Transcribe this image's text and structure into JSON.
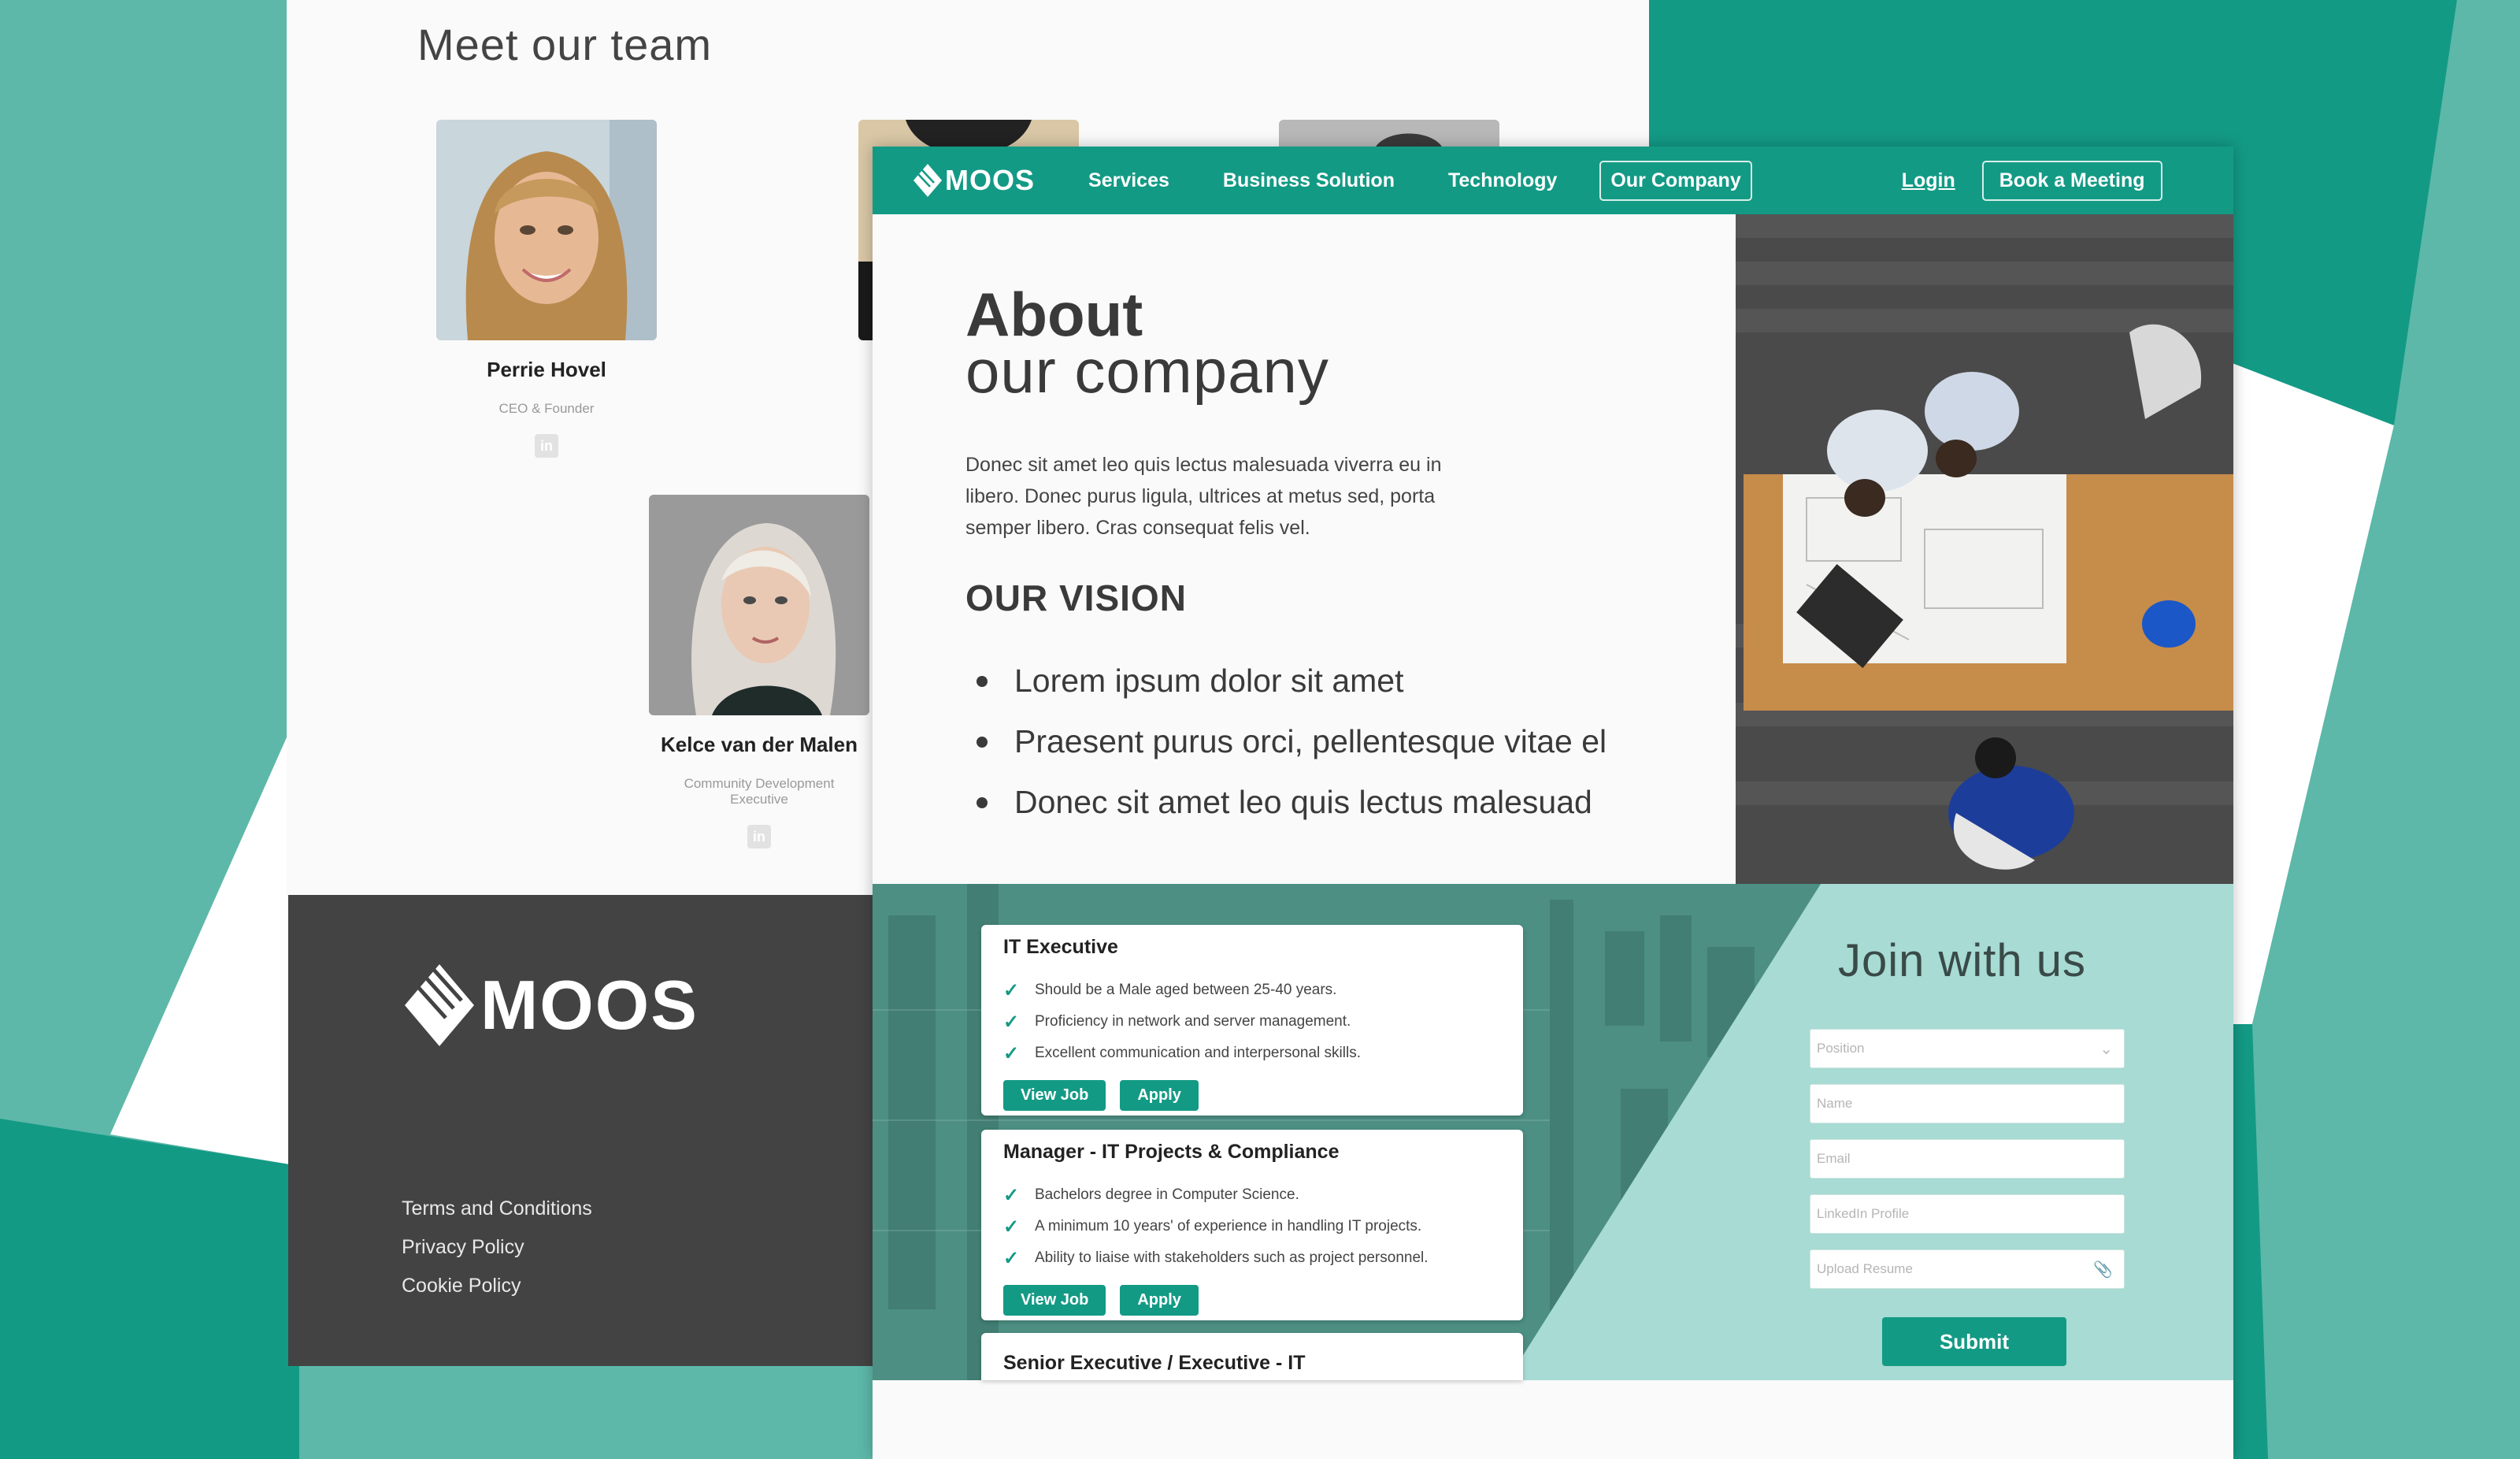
{
  "team": {
    "title": "Meet our team",
    "members": [
      {
        "name": "Perrie Hovel",
        "role": "CEO & Founder",
        "linkedin": "in"
      },
      {
        "name": "Kelce van der Malen",
        "role_line1": "Community Development",
        "role_line2": "Executive",
        "linkedin": "in"
      }
    ]
  },
  "footer": {
    "logo_text": "MOOS",
    "links": [
      "Terms and Conditions",
      "Privacy Policy",
      "Cookie Policy"
    ]
  },
  "nav": {
    "logo_text": "MOOS",
    "items": [
      "Services",
      "Business Solution",
      "Technology",
      "Our Company"
    ],
    "active_item": "Our Company",
    "login": "Login",
    "book": "Book a Meeting"
  },
  "about": {
    "title_bold": "About",
    "title_light": "our company",
    "description": "Donec sit amet leo quis lectus malesuada viverra eu in libero. Donec purus ligula, ultrices at metus sed, porta semper libero. Cras consequat felis vel.",
    "vision_title": "OUR VISION",
    "vision_items": [
      "Lorem ipsum dolor sit amet",
      "Praesent purus orci, pellentesque vitae el",
      "Donec sit amet leo quis lectus malesuad"
    ]
  },
  "jobs": [
    {
      "title": "IT Executive",
      "requirements": [
        "Should be a Male aged between 25-40 years.",
        "Proficiency in network and server management.",
        "Excellent communication and interpersonal skills."
      ],
      "view_label": "View Job",
      "apply_label": "Apply"
    },
    {
      "title": "Manager - IT Projects & Compliance",
      "requirements": [
        "Bachelors degree in Computer Science.",
        "A minimum 10 years' of experience in handling IT projects.",
        "Ability to liaise with stakeholders such as project personnel."
      ],
      "view_label": "View Job",
      "apply_label": "Apply"
    },
    {
      "title": "Senior Executive / Executive - IT"
    }
  ],
  "join": {
    "title": "Join with us",
    "fields": {
      "position": "Position",
      "name": "Name",
      "email": "Email",
      "linkedin": "LinkedIn Profile",
      "resume": "Upload Resume"
    },
    "submit": "Submit"
  },
  "colors": {
    "brand_teal": "#139a85",
    "light_teal": "#5db8a9",
    "join_panel": "#a7dbd3",
    "footer_dark": "#434343"
  }
}
